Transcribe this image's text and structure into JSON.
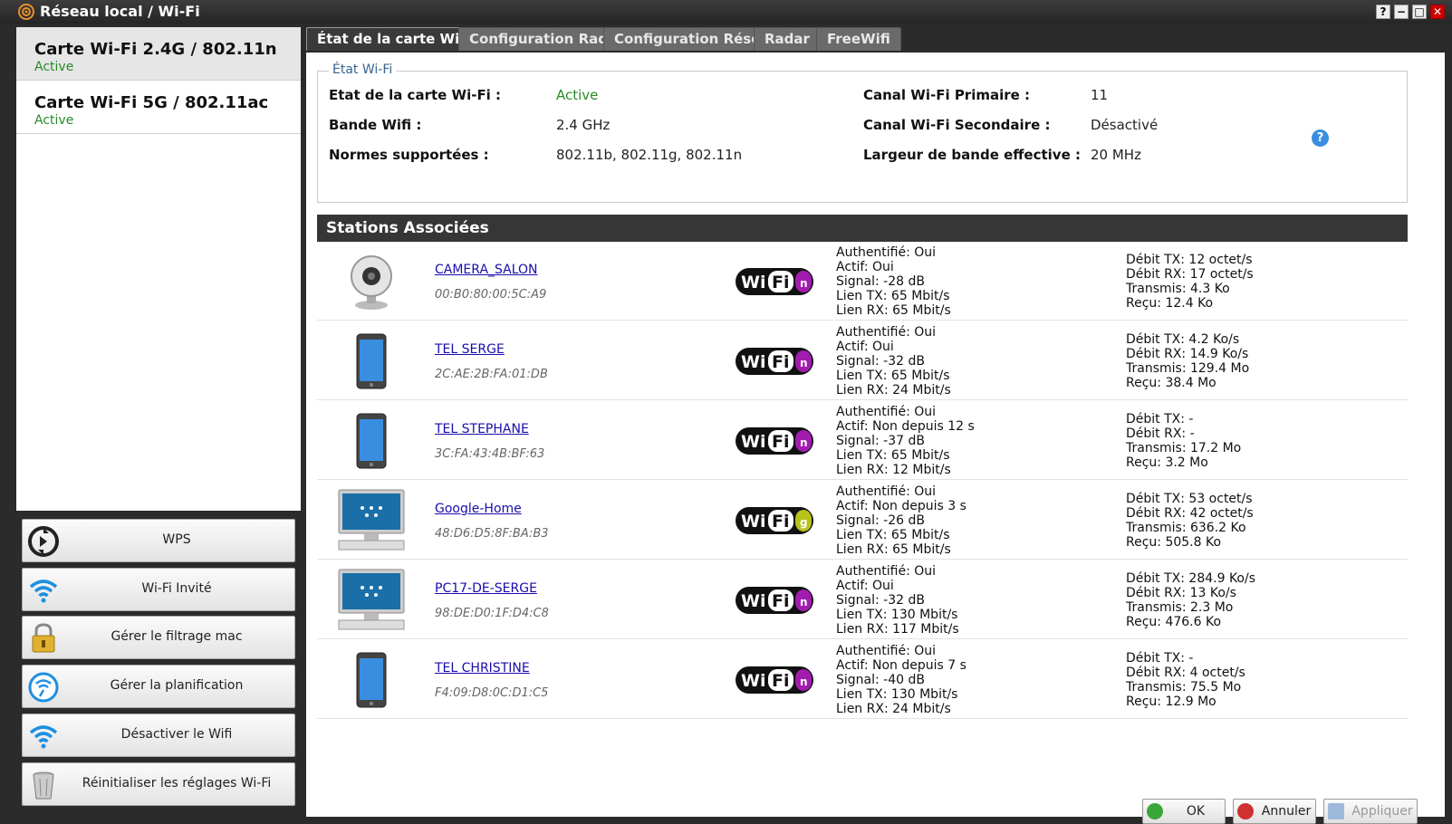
{
  "window": {
    "title": "Réseau local / Wi-Fi",
    "controls": [
      "?",
      "−",
      "□",
      "✕"
    ]
  },
  "cards": [
    {
      "title": "Carte Wi-Fi 2.4G / 802.11n",
      "status": "Active"
    },
    {
      "title": "Carte Wi-Fi 5G / 802.11ac",
      "status": "Active"
    }
  ],
  "actions": [
    {
      "label": "WPS",
      "icon": "wps-icon"
    },
    {
      "label": "Wi-Fi Invité",
      "icon": "wifi-icon"
    },
    {
      "label": "Gérer le filtrage mac",
      "icon": "lock-icon"
    },
    {
      "label": "Gérer la planification",
      "icon": "schedule-icon"
    },
    {
      "label": "Désactiver le Wifi",
      "icon": "wifi-icon"
    },
    {
      "label": "Réinitialiser les réglages Wi-Fi",
      "icon": "trash-icon"
    }
  ],
  "tabs": [
    "État de la carte Wi-Fi",
    "Configuration Radio",
    "Configuration Réseau",
    "Radar",
    "FreeWifi"
  ],
  "status": {
    "legend": "État Wi-Fi",
    "rows": [
      {
        "l1": "Etat de la carte Wi-Fi :",
        "v1": "Active",
        "l2": "Canal Wi-Fi Primaire :",
        "v2": "11"
      },
      {
        "l1": "Bande Wifi :",
        "v1": "2.4 GHz",
        "l2": "Canal Wi-Fi Secondaire :",
        "v2": "Désactivé"
      },
      {
        "l1": "Normes supportées :",
        "v1": "802.11b, 802.11g, 802.11n",
        "l2": "Largeur de bande effective :",
        "v2": "20 MHz"
      }
    ],
    "help": "?"
  },
  "stations_title": "Stations Associées",
  "stations": [
    {
      "name": "CAMERA_SALON",
      "mac": "00:B0:80:00:5C:A9",
      "icon": "camera-icon",
      "mode": "n",
      "auth": "Authentifié: Oui",
      "actif": "Actif: Oui",
      "signal": "Signal: -28 dB",
      "ltx": "Lien TX: 65 Mbit/s",
      "lrx": "Lien RX: 65 Mbit/s",
      "dtx": "Débit TX: 12 octet/s",
      "drx": "Débit RX: 17 octet/s",
      "trans": "Transmis: 4.3 Ko",
      "recu": "Reçu: 12.4 Ko"
    },
    {
      "name": "TEL SERGE",
      "mac": "2C:AE:2B:FA:01:DB",
      "icon": "phone-icon",
      "mode": "n",
      "auth": "Authentifié: Oui",
      "actif": "Actif: Oui",
      "signal": "Signal: -32 dB",
      "ltx": "Lien TX: 65 Mbit/s",
      "lrx": "Lien RX: 24 Mbit/s",
      "dtx": "Débit TX: 4.2 Ko/s",
      "drx": "Débit RX: 14.9 Ko/s",
      "trans": "Transmis: 129.4 Mo",
      "recu": "Reçu: 38.4 Mo"
    },
    {
      "name": "TEL STEPHANE",
      "mac": "3C:FA:43:4B:BF:63",
      "icon": "phone-icon",
      "mode": "n",
      "auth": "Authentifié: Oui",
      "actif": "Actif: Non depuis 12 s",
      "signal": "Signal: -37 dB",
      "ltx": "Lien TX: 65 Mbit/s",
      "lrx": "Lien RX: 12 Mbit/s",
      "dtx": "Débit TX: -",
      "drx": "Débit RX: -",
      "trans": "Transmis: 17.2 Mo",
      "recu": "Reçu: 3.2 Mo"
    },
    {
      "name": "Google-Home",
      "mac": "48:D6:D5:8F:BA:B3",
      "icon": "computer-icon",
      "mode": "g",
      "auth": "Authentifié: Oui",
      "actif": "Actif: Non depuis 3 s",
      "signal": "Signal: -26 dB",
      "ltx": "Lien TX: 65 Mbit/s",
      "lrx": "Lien RX: 65 Mbit/s",
      "dtx": "Débit TX: 53 octet/s",
      "drx": "Débit RX: 42 octet/s",
      "trans": "Transmis: 636.2 Ko",
      "recu": "Reçu: 505.8 Ko"
    },
    {
      "name": "PC17-DE-SERGE",
      "mac": "98:DE:D0:1F:D4:C8",
      "icon": "computer-icon",
      "mode": "n",
      "auth": "Authentifié: Oui",
      "actif": "Actif: Oui",
      "signal": "Signal: -32 dB",
      "ltx": "Lien TX: 130 Mbit/s",
      "lrx": "Lien RX: 117 Mbit/s",
      "dtx": "Débit TX: 284.9 Ko/s",
      "drx": "Débit RX: 13 Ko/s",
      "trans": "Transmis: 2.3 Mo",
      "recu": "Reçu: 476.6 Ko"
    },
    {
      "name": "TEL CHRISTINE",
      "mac": "F4:09:D8:0C:D1:C5",
      "icon": "phone-icon",
      "mode": "n",
      "auth": "Authentifié: Oui",
      "actif": "Actif: Non depuis 7 s",
      "signal": "Signal: -40 dB",
      "ltx": "Lien TX: 130 Mbit/s",
      "lrx": "Lien RX: 24 Mbit/s",
      "dtx": "Débit TX: -",
      "drx": "Débit RX: 4 octet/s",
      "trans": "Transmis: 75.5 Mo",
      "recu": "Reçu: 12.9 Mo"
    }
  ],
  "wifi_logo_text": "WiFi",
  "footer": {
    "ok": "OK",
    "cancel": "Annuler",
    "apply": "Appliquer"
  },
  "colors": {
    "active_green": "#2a8a2a",
    "link_blue": "#1a0dab",
    "wifi_n": "#a21caf",
    "wifi_g": "#b7c21a"
  }
}
